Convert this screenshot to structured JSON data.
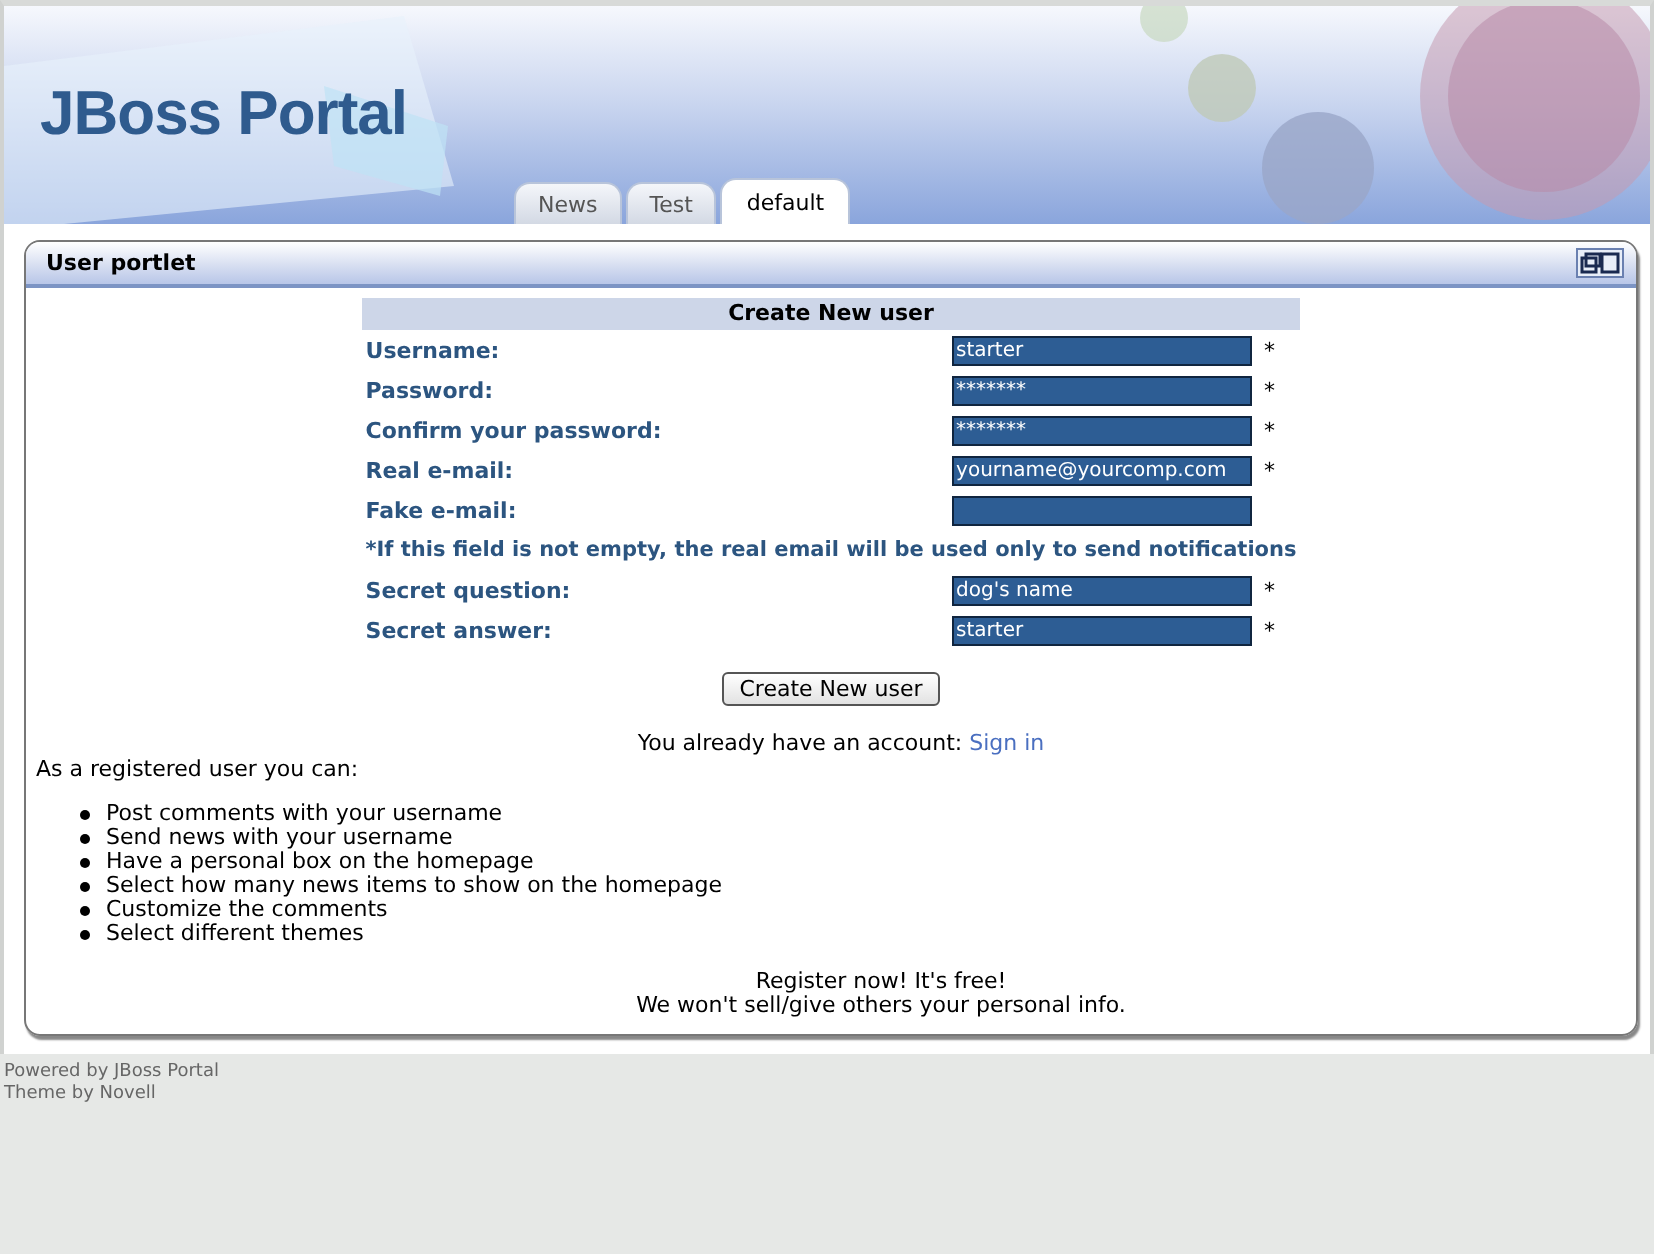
{
  "header": {
    "logo": "JBoss Portal"
  },
  "tabs": [
    {
      "label": "News",
      "selected": false
    },
    {
      "label": "Test",
      "selected": false
    },
    {
      "label": "default",
      "selected": true
    }
  ],
  "portlet": {
    "title": "User portlet",
    "form": {
      "heading": "Create New user",
      "rows": [
        {
          "kind": "field",
          "label": "Username:",
          "value": "starter",
          "marker": "*"
        },
        {
          "kind": "field",
          "label": "Password:",
          "value": "*******",
          "marker": "*"
        },
        {
          "kind": "field",
          "label": "Confirm your password:",
          "value": "*******",
          "marker": "*"
        },
        {
          "kind": "field",
          "label": "Real e-mail:",
          "value": "yourname@yourcomp.com",
          "marker": "*"
        },
        {
          "kind": "field",
          "label": "Fake e-mail:"
        },
        {
          "kind": "note",
          "text": "*If this field is not empty, the real email will be used only to send notifications"
        },
        {
          "kind": "field",
          "label": "Secret question:",
          "value": "dog's name",
          "marker": "*"
        },
        {
          "kind": "field",
          "label": "Secret answer:",
          "value": "starter",
          "marker": "*"
        }
      ],
      "button": "Create New user"
    },
    "account_prompt": "You already have an account:",
    "sign_in": "Sign in",
    "intro": "As a registered user you can:",
    "benefits": [
      "Post comments with your username",
      "Send news with your username",
      "Have a personal box on the homepage",
      "Select how many news items to show on the homepage",
      "Customize the comments",
      "Select different themes"
    ],
    "closing": [
      "Register now! It's free!",
      "We won't sell/give others your personal info."
    ]
  },
  "footer": [
    "Powered by JBoss Portal",
    "Theme by Novell"
  ]
}
